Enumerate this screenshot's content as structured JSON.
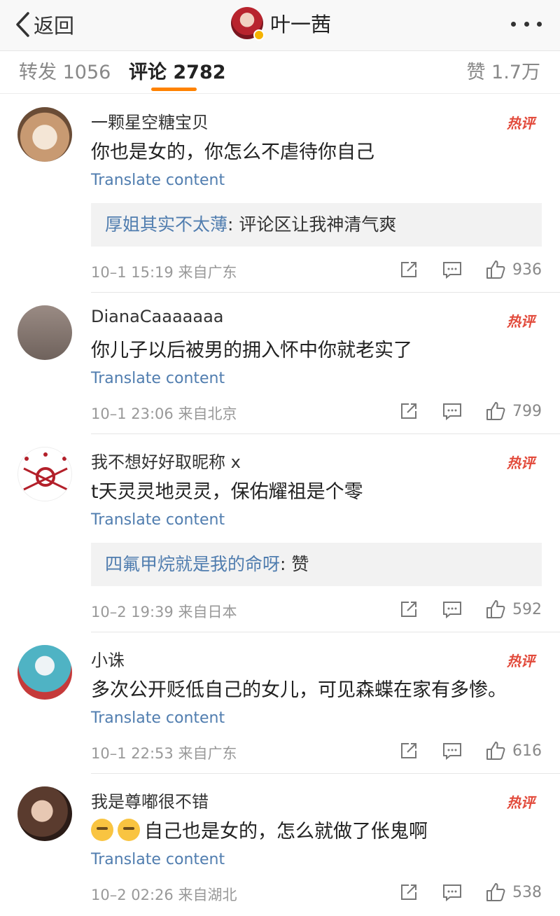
{
  "nav": {
    "back_label": "返回",
    "title": "叶一茜"
  },
  "tabs": {
    "forward": "转发 1056",
    "comments": "评论 2782",
    "likes": "赞 1.7万"
  },
  "hot_label": "热评",
  "translate_label": "Translate content",
  "comments": [
    {
      "name": "一颗星空糖宝贝",
      "text": "你也是女的，你怎么不虐待你自己",
      "reply_name": "厚姐其实不太薄",
      "reply_text": ": 评论区让我神清气爽",
      "time": "10–1 15:19  来自广东",
      "likes": "936"
    },
    {
      "name": "DianaCaaaaaaa",
      "text": "你儿子以后被男的拥入怀中你就老实了",
      "time": "10–1 23:06  来自北京",
      "likes": "799"
    },
    {
      "name": "我不想好好取昵称 x",
      "text": "t天灵灵地灵灵，保佑耀祖是个零",
      "reply_name": "四氟甲烷就是我的命呀",
      "reply_text": ": 赞",
      "time": "10–2 19:39  来自日本",
      "likes": "592"
    },
    {
      "name": "小诛",
      "text": "多次公开贬低自己的女儿，可见森蝶在家有多惨。",
      "time": "10–1 22:53  来自广东",
      "likes": "616"
    },
    {
      "name": "我是尊嘟很不错",
      "text": "自己也是女的，怎么就做了伥鬼啊",
      "time": "10–2 02:26  来自湖北",
      "likes": "538"
    }
  ],
  "icons": {
    "back": "chevron-left-icon",
    "more": "more-dots-icon",
    "share": "share-icon",
    "reply": "comment-icon",
    "like": "thumbs-up-icon"
  },
  "colors": {
    "accent": "#ff8200",
    "link": "#507daf",
    "hot": "#e24a3b"
  }
}
